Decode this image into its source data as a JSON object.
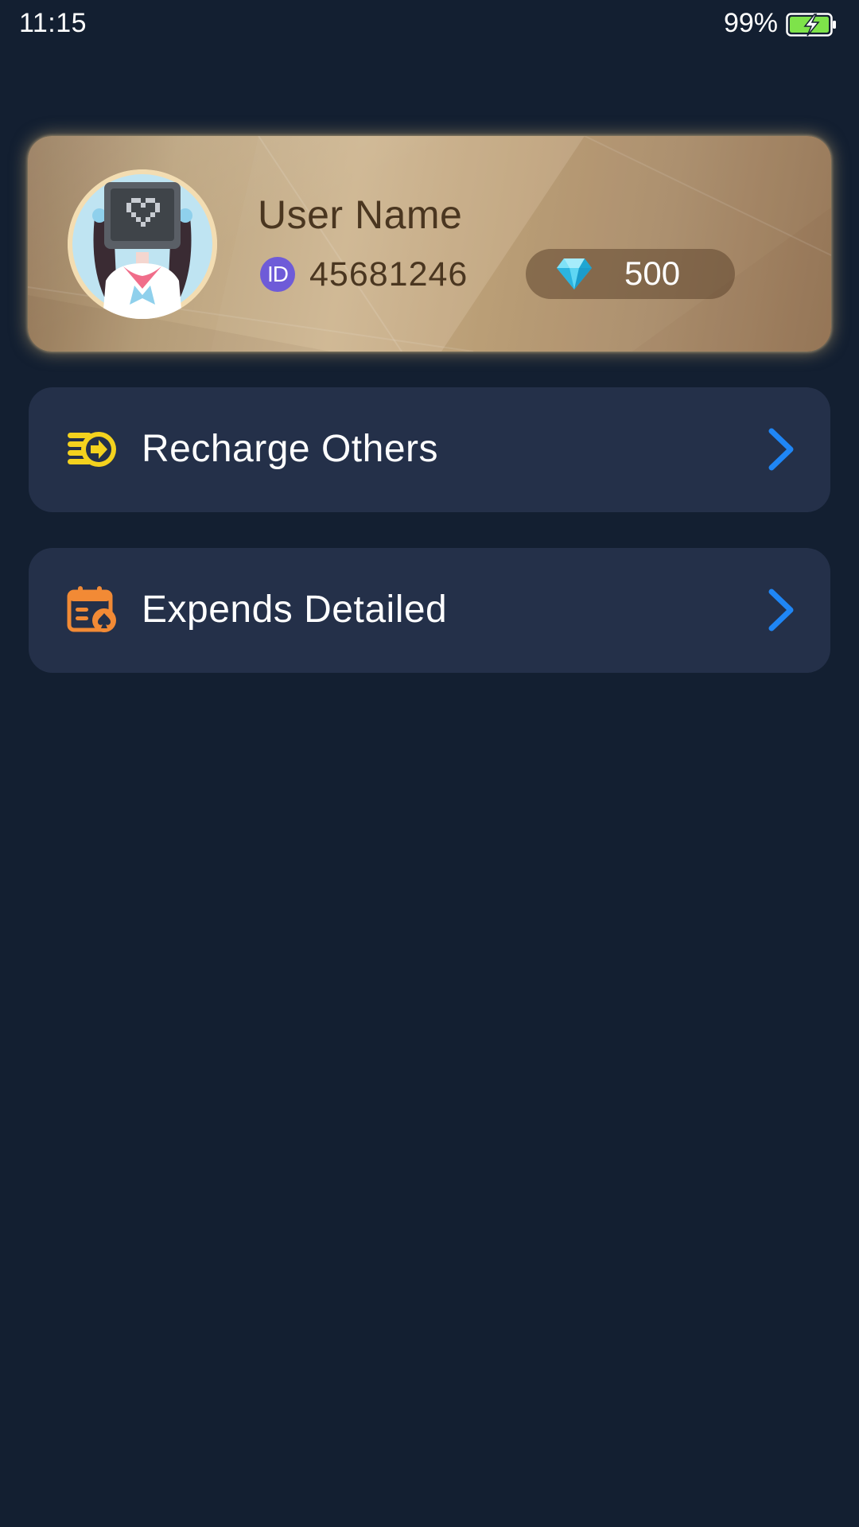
{
  "status_bar": {
    "time": "11:15",
    "battery_percent": "99%",
    "battery_level": 0.99,
    "charging": true,
    "battery_color": "#7ee34a"
  },
  "profile": {
    "name": "User Name",
    "id_badge": "ID",
    "id_value": "45681246",
    "diamonds": "500",
    "avatar_icon": "avatar-girl-monitor-head-icon",
    "diamond_icon": "diamond-icon",
    "id_badge_color": "#6e5bd8"
  },
  "menu": [
    {
      "label": "Recharge Others",
      "icon": "recharge-coins-icon",
      "icon_color": "#f4d21e",
      "chevron_color": "#1f86f5"
    },
    {
      "label": "Expends Detailed",
      "icon": "calendar-spade-icon",
      "icon_color": "#f28a35",
      "chevron_color": "#1f86f5"
    }
  ],
  "colors": {
    "background": "#131f31",
    "row_background": "#243049",
    "card_gold": "#c1a47c"
  }
}
